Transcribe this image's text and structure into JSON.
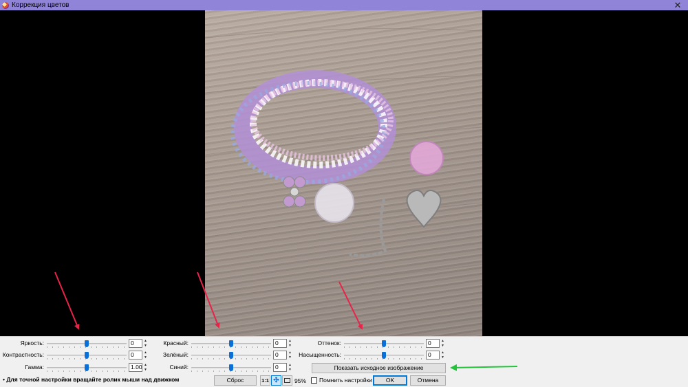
{
  "window": {
    "title": "Коррекция цветов",
    "close_glyph": "✕"
  },
  "sliders_left": [
    {
      "label": "Яркость:",
      "value": "0",
      "level": 0.5
    },
    {
      "label": "Контрастность:",
      "value": "0",
      "level": 0.5
    },
    {
      "label": "Гамма:",
      "value": "1.00",
      "level": 0.5
    }
  ],
  "sliders_mid": [
    {
      "label": "Красный:",
      "value": "0",
      "level": 0.5
    },
    {
      "label": "Зелёный:",
      "value": "0",
      "level": 0.5
    },
    {
      "label": "Синий:",
      "value": "0",
      "level": 0.5
    }
  ],
  "sliders_right": [
    {
      "label": "Оттенок:",
      "value": "0",
      "level": 0.5
    },
    {
      "label": "Насыщенность:",
      "value": "0",
      "level": 0.5
    }
  ],
  "buttons": {
    "show_original": "Показать исходное изображение",
    "reset": "Сброс",
    "actual_size": "1:1",
    "fit": "✣",
    "ok": "OK",
    "cancel": "Отмена"
  },
  "zoom": "95%",
  "remember_label": "Помнить настройки",
  "remember_checked": false,
  "hint": "• Для точной настройки вращайте ролик мыши над движком",
  "colors": {
    "titlebar": "#8f84d8",
    "thumb": "#0a6fd6",
    "arrow_red": "#e8234a",
    "arrow_green": "#22c43a"
  }
}
